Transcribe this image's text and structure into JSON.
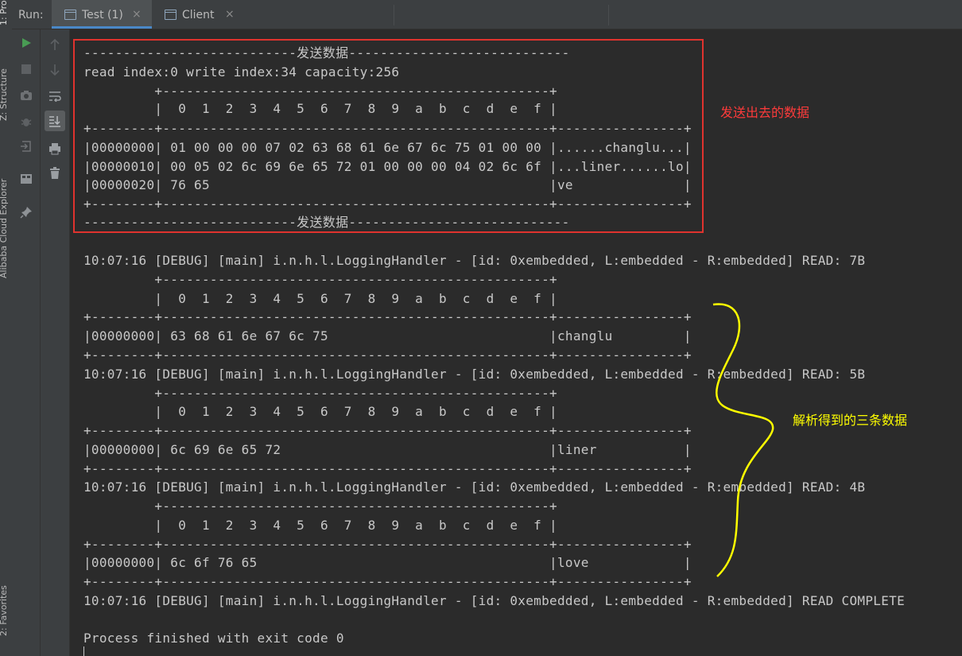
{
  "left_tabs": {
    "project": "1: Pro",
    "structure": "Z: Structure",
    "cloud_explorer": "Alibaba Cloud Explorer",
    "favorites": "2: Favorites"
  },
  "run_panel": {
    "label": "Run:",
    "tabs": [
      {
        "label": "Test (1)",
        "close": "×",
        "active": true
      },
      {
        "label": "Client",
        "close": "×",
        "active": false
      }
    ]
  },
  "toolbar_icons": [
    "run-icon",
    "stop-icon",
    "camera-icon",
    "bug-icon",
    "exit-icon",
    "layout-icon",
    "pin-icon",
    "up-arrow-icon",
    "down-arrow-icon",
    "soft-wrap-icon",
    "scroll-to-end-icon",
    "print-icon",
    "trash-icon"
  ],
  "console": {
    "lines": [
      "---------------------------发送数据----------------------------",
      "read index:0 write index:34 capacity:256",
      "         +-------------------------------------------------+",
      "         |  0  1  2  3  4  5  6  7  8  9  a  b  c  d  e  f |",
      "+--------+-------------------------------------------------+----------------+",
      "|00000000| 01 00 00 00 07 02 63 68 61 6e 67 6c 75 01 00 00 |......changlu...|",
      "|00000010| 00 05 02 6c 69 6e 65 72 01 00 00 00 04 02 6c 6f |...liner......lo|",
      "|00000020| 76 65                                           |ve              |",
      "+--------+-------------------------------------------------+----------------+",
      "---------------------------发送数据----------------------------",
      "10:07:16 [DEBUG] [main] i.n.h.l.LoggingHandler - [id: 0xembedded, L:embedded - R:embedded] READ: 7B",
      "         +-------------------------------------------------+",
      "         |  0  1  2  3  4  5  6  7  8  9  a  b  c  d  e  f |",
      "+--------+-------------------------------------------------+----------------+",
      "|00000000| 63 68 61 6e 67 6c 75                            |changlu         |",
      "+--------+-------------------------------------------------+----------------+",
      "10:07:16 [DEBUG] [main] i.n.h.l.LoggingHandler - [id: 0xembedded, L:embedded - R:embedded] READ: 5B",
      "         +-------------------------------------------------+",
      "         |  0  1  2  3  4  5  6  7  8  9  a  b  c  d  e  f |",
      "+--------+-------------------------------------------------+----------------+",
      "|00000000| 6c 69 6e 65 72                                  |liner           |",
      "+--------+-------------------------------------------------+----------------+",
      "10:07:16 [DEBUG] [main] i.n.h.l.LoggingHandler - [id: 0xembedded, L:embedded - R:embedded] READ: 4B",
      "         +-------------------------------------------------+",
      "         |  0  1  2  3  4  5  6  7  8  9  a  b  c  d  e  f |",
      "+--------+-------------------------------------------------+----------------+",
      "|00000000| 6c 6f 76 65                                     |love            |",
      "+--------+-------------------------------------------------+----------------+",
      "10:07:16 [DEBUG] [main] i.n.h.l.LoggingHandler - [id: 0xembedded, L:embedded - R:embedded] READ COMPLETE",
      "Process finished with exit code 0"
    ]
  },
  "annotations": {
    "sent_data": "发送出去的数据",
    "parsed_data": "解析得到的三条数据"
  },
  "colors": {
    "console_bg": "#2b2b2b",
    "console_text": "#c8c8c8",
    "panel_bg": "#3c3f41",
    "highlight_box": "#e0332e",
    "annotation_red": "#ff3b3b",
    "annotation_yellow": "#ffff00",
    "run_green": "#499c54"
  }
}
